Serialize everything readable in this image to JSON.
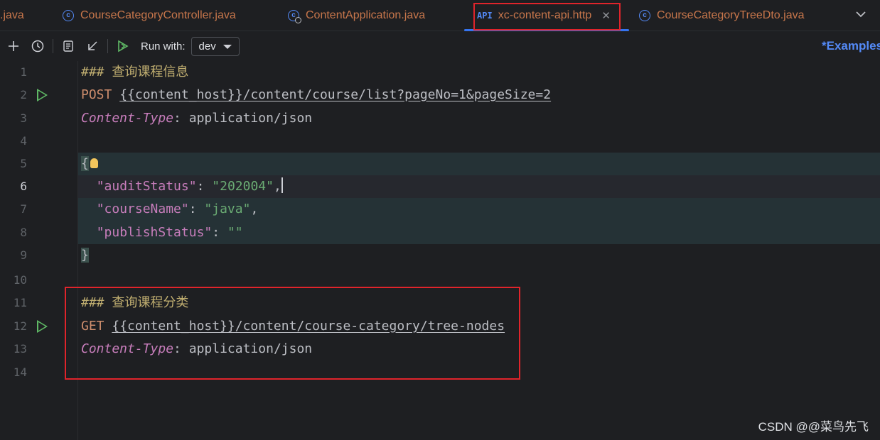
{
  "tabs": [
    {
      "label": ".java",
      "icon": "none"
    },
    {
      "label": "CourseCategoryController.java",
      "icon": "class-icon"
    },
    {
      "label": "ContentApplication.java",
      "icon": "class-gear-icon"
    },
    {
      "label": "xc-content-api.http",
      "icon": "api-icon",
      "active": true,
      "icon_text": "API"
    },
    {
      "label": "CourseCategoryTreeDto.java",
      "icon": "class-icon"
    }
  ],
  "toolbar": {
    "run_with_label": "Run with:",
    "env_value": "dev",
    "examples_link": "*Examples"
  },
  "editor": {
    "line_numbers": [
      "1",
      "2",
      "3",
      "4",
      "5",
      "6",
      "7",
      "8",
      "9",
      "10",
      "11",
      "12",
      "13",
      "14"
    ],
    "current_line": 6,
    "lines": {
      "l1_comment": "### 查询课程信息",
      "l2_method": "POST",
      "l2_url": "{{content_host}}/content/course/list?pageNo=1&pageSize=2",
      "l3_key": "Content-Type",
      "l3_sep": ": ",
      "l3_val": "application/json",
      "l5_brace": "{",
      "l6_key": "\"auditStatus\"",
      "l6_val": "\"202004\"",
      "l7_key": "\"courseName\"",
      "l7_val": "\"java\"",
      "l8_key": "\"publishStatus\"",
      "l8_val": "\"\"",
      "l9_brace": "}",
      "l11_comment": "### 查询课程分类",
      "l12_method": "GET",
      "l12_url": "{{content_host}}/content/course-category/tree-nodes",
      "l13_key": "Content-Type",
      "l13_sep": ": ",
      "l13_val": "application/json"
    }
  },
  "watermark": "CSDN @@菜鸟先飞",
  "colors": {
    "highlight": "#e0242b",
    "accent": "#3574f0"
  }
}
